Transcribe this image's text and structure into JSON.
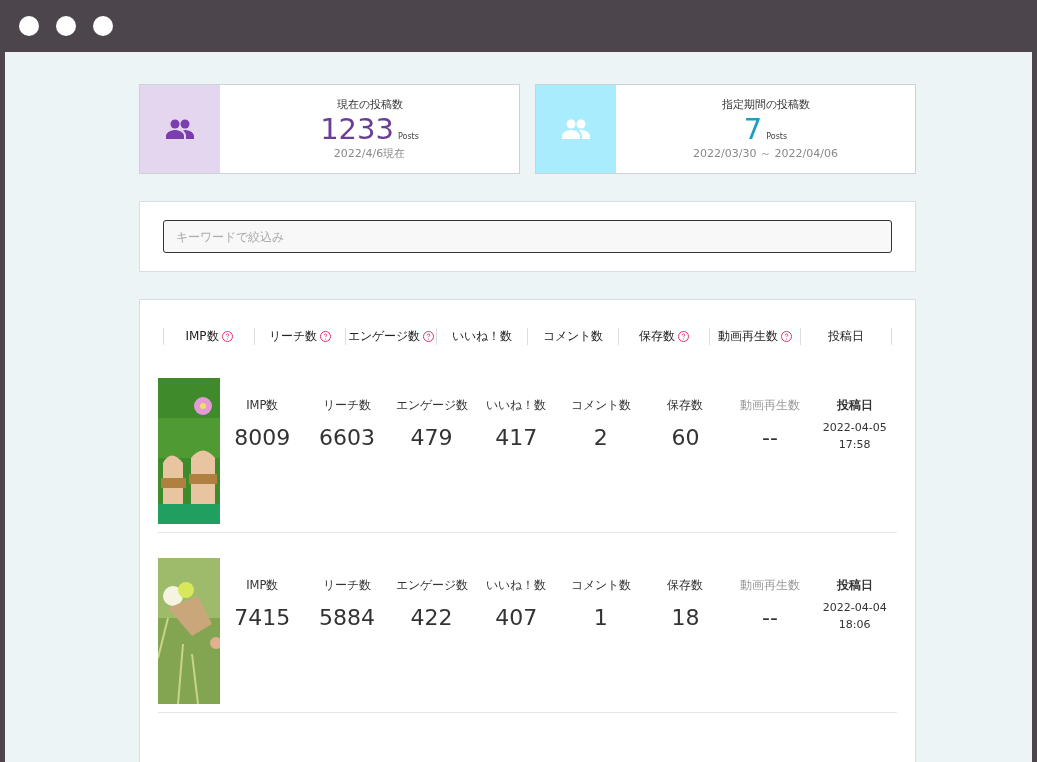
{
  "stats": [
    {
      "kind": "total",
      "title": "現在の投稿数",
      "value": "1233",
      "unit": "Posts",
      "note": "2022/4/6現在"
    },
    {
      "kind": "period",
      "title": "指定期間の投稿数",
      "value": "7",
      "unit": "Posts",
      "note": "2022/03/30 ～ 2022/04/06"
    }
  ],
  "search": {
    "placeholder": "キーワードで絞込み"
  },
  "table": {
    "columns": [
      {
        "label": "IMP数",
        "help": true
      },
      {
        "label": "リーチ数",
        "help": true
      },
      {
        "label": "エンゲージ数",
        "help": true
      },
      {
        "label": "いいね！数",
        "help": false
      },
      {
        "label": "コメント数",
        "help": false
      },
      {
        "label": "保存数",
        "help": true
      },
      {
        "label": "動画再生数",
        "help": true
      },
      {
        "label": "投稿日",
        "help": false
      }
    ],
    "rows": [
      {
        "picture": {
          "kind": "picture"
        },
        "metrics": [
          {
            "label": "IMP数",
            "value": "8009",
            "muted": false
          },
          {
            "label": "リーチ数",
            "value": "6603",
            "muted": false
          },
          {
            "label": "エンゲージ数",
            "value": "479",
            "muted": false
          },
          {
            "label": "いいね！数",
            "value": "417",
            "muted": false
          },
          {
            "label": "コメント数",
            "value": "2",
            "muted": false
          },
          {
            "label": "保存数",
            "value": "60",
            "muted": false
          },
          {
            "label": "動画再生数",
            "value": "--",
            "muted": true
          }
        ],
        "date_label": "投稿日",
        "date": "2022-04-05",
        "time": "17:58"
      },
      {
        "picture": {
          "kind": "picture"
        },
        "metrics": [
          {
            "label": "IMP数",
            "value": "7415",
            "muted": false
          },
          {
            "label": "リーチ数",
            "value": "5884",
            "muted": false
          },
          {
            "label": "エンゲージ数",
            "value": "422",
            "muted": false
          },
          {
            "label": "いいね！数",
            "value": "407",
            "muted": false
          },
          {
            "label": "コメント数",
            "value": "1",
            "muted": false
          },
          {
            "label": "保存数",
            "value": "18",
            "muted": false
          },
          {
            "label": "動画再生数",
            "value": "--",
            "muted": true
          }
        ],
        "date_label": "投稿日",
        "date": "2022-04-04",
        "time": "18:06"
      }
    ]
  }
}
